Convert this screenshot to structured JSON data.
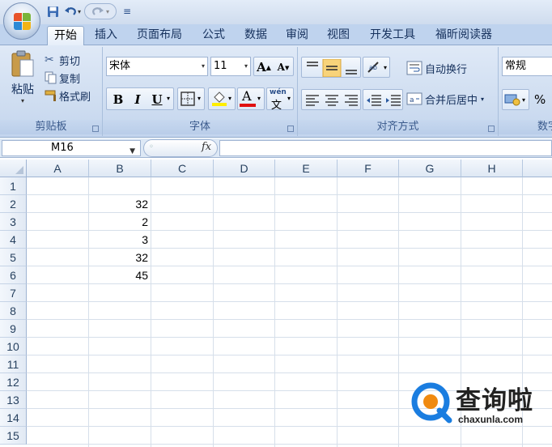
{
  "qat": {
    "save_icon": "save-icon",
    "undo_icon": "undo-icon",
    "redo_icon": "redo-icon"
  },
  "tabs": [
    {
      "label": "开始",
      "active": true
    },
    {
      "label": "插入"
    },
    {
      "label": "页面布局"
    },
    {
      "label": "公式"
    },
    {
      "label": "数据"
    },
    {
      "label": "审阅"
    },
    {
      "label": "视图"
    },
    {
      "label": "开发工具"
    },
    {
      "label": "福昕阅读器"
    }
  ],
  "clipboard": {
    "paste": "粘贴",
    "cut": "剪切",
    "copy": "复制",
    "format_painter": "格式刷",
    "group_label": "剪贴板"
  },
  "font": {
    "name": "宋体",
    "size": "11",
    "bold": "B",
    "italic": "I",
    "underline": "U",
    "grow": "A",
    "shrink": "A",
    "font_color_letter": "A",
    "phonetic": "wén",
    "phonetic_char": "文",
    "group_label": "字体"
  },
  "alignment": {
    "wrap_text": "自动换行",
    "merge_center": "合并后居中",
    "group_label": "对齐方式"
  },
  "number": {
    "format": "常规",
    "percent": "%",
    "group_label": "数字"
  },
  "formula_bar": {
    "name_box": "M16",
    "fx_label": "fx",
    "formula": ""
  },
  "sheet": {
    "columns": [
      "A",
      "B",
      "C",
      "D",
      "E",
      "F",
      "G",
      "H"
    ],
    "rows": [
      "1",
      "2",
      "3",
      "4",
      "5",
      "6",
      "7",
      "8",
      "9",
      "10",
      "11",
      "12",
      "13",
      "14",
      "15"
    ],
    "column_b_values": [
      {
        "row": "2",
        "value": "32"
      },
      {
        "row": "3",
        "value": "2"
      },
      {
        "row": "4",
        "value": "3"
      },
      {
        "row": "5",
        "value": "32"
      },
      {
        "row": "6",
        "value": "45"
      }
    ]
  },
  "watermark": {
    "title": "查询啦",
    "url": "chaxunla.com"
  },
  "colors": {
    "ribbon": "#cddcf0",
    "tab_bar": "#bfd3ee",
    "grid_line": "#d6dfea",
    "font_color_bar": "#e01010",
    "highlight_bar": "#ffee00",
    "watermark_blue": "#1a7de0",
    "watermark_orange": "#f08a10"
  }
}
